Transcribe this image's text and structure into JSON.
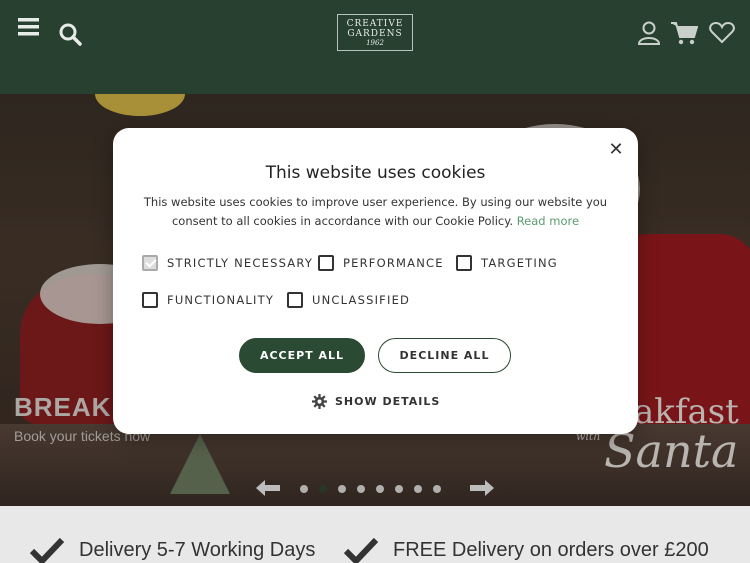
{
  "header": {
    "logo": {
      "line1": "CREATIVE",
      "line2": "GARDENS",
      "line3": "1962"
    }
  },
  "hero": {
    "title": "BREAKFAST",
    "subtitle": "Book your tickets now",
    "brand_text_a": "akfast",
    "brand_with": "with",
    "brand_text_b": "Santa",
    "slide_count": 8,
    "active_slide": 1
  },
  "cookie_banner": {
    "title": "This website uses cookies",
    "body": "This website uses cookies to improve user experience. By using our website you consent to all cookies in accordance with our Cookie Policy.",
    "read_more": "Read more",
    "options": [
      {
        "label": "STRICTLY NECESSARY",
        "checked": true
      },
      {
        "label": "PERFORMANCE",
        "checked": false
      },
      {
        "label": "TARGETING",
        "checked": false
      },
      {
        "label": "FUNCTIONALITY",
        "checked": false
      },
      {
        "label": "UNCLASSIFIED",
        "checked": false
      }
    ],
    "accept_label": "ACCEPT ALL",
    "decline_label": "DECLINE ALL",
    "details_label": "SHOW DETAILS",
    "close_glyph": "✕"
  },
  "features": [
    {
      "text": "Delivery 5-7 Working Days"
    },
    {
      "text": "FREE Delivery on orders over £200"
    }
  ],
  "colors": {
    "header_bg": "#27402f",
    "accent": "#2b4a33",
    "link": "#5c9b6e"
  }
}
